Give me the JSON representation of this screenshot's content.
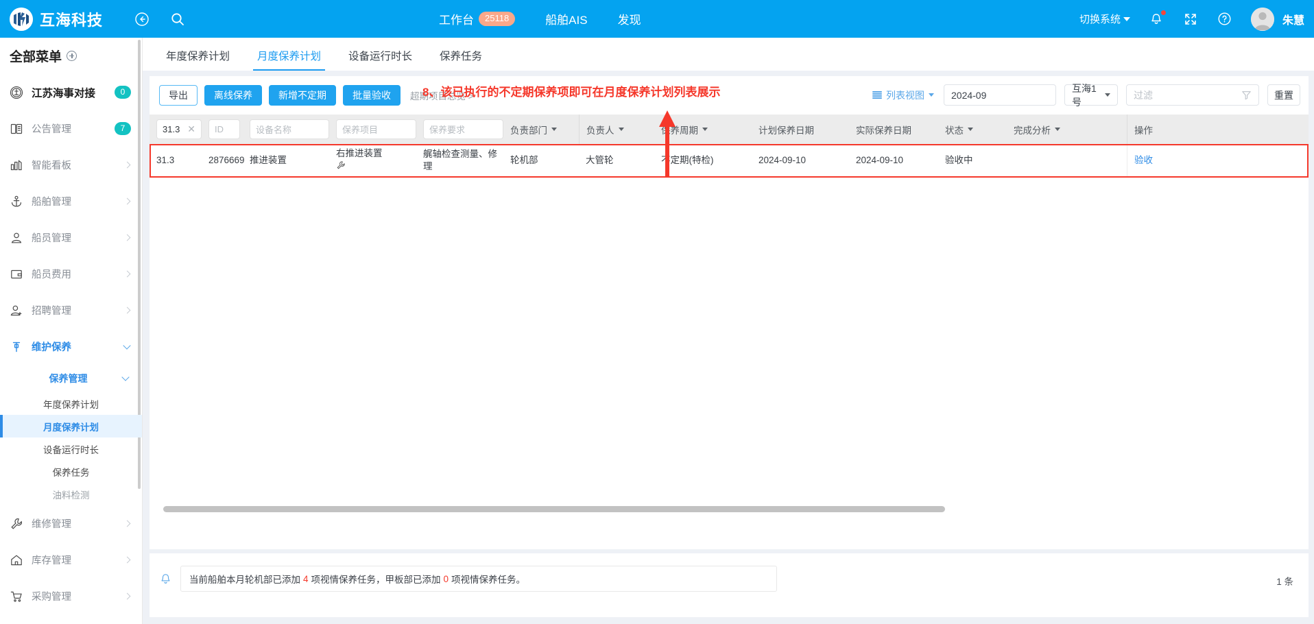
{
  "header": {
    "brand": "互海科技",
    "back_icon": "back-arrow-icon",
    "search_icon": "search-icon",
    "center_links": [
      {
        "label": "工作台",
        "badge": "25118"
      },
      {
        "label": "船舶AIS",
        "badge": ""
      },
      {
        "label": "发现",
        "badge": ""
      }
    ],
    "switch_system": "切换系统",
    "user_name": "朱慧"
  },
  "sidebar": {
    "title": "全部菜单",
    "items": [
      {
        "label": "江苏海事对接",
        "badge": "0",
        "icon": "maritime-seal-icon",
        "arrow": "",
        "strong": true
      },
      {
        "label": "公告管理",
        "badge": "7",
        "icon": "book-icon",
        "arrow": ""
      },
      {
        "label": "智能看板",
        "badge": "",
        "icon": "bar-chart-icon",
        "arrow": "chevron-right"
      },
      {
        "label": "船舶管理",
        "badge": "",
        "icon": "anchor-icon",
        "arrow": "chevron-right"
      },
      {
        "label": "船员管理",
        "badge": "",
        "icon": "user-icon",
        "arrow": "chevron-right"
      },
      {
        "label": "船员费用",
        "badge": "",
        "icon": "wallet-icon",
        "arrow": "chevron-right"
      },
      {
        "label": "招聘管理",
        "badge": "",
        "icon": "user-add-icon",
        "arrow": "chevron-right"
      },
      {
        "label": "维护保养",
        "badge": "",
        "icon": "maintenance-icon",
        "arrow": "chevron-down",
        "active": true
      }
    ],
    "sub_group": "保养管理",
    "leaves": [
      {
        "label": "年度保养计划",
        "selected": false,
        "muted": false
      },
      {
        "label": "月度保养计划",
        "selected": true,
        "muted": false
      },
      {
        "label": "设备运行时长",
        "selected": false,
        "muted": false
      },
      {
        "label": "保养任务",
        "selected": false,
        "muted": false
      },
      {
        "label": "油料检测",
        "selected": false,
        "muted": true
      }
    ],
    "tail_items": [
      {
        "label": "维修管理",
        "icon": "wrench-icon",
        "arrow": "chevron-right"
      },
      {
        "label": "库存管理",
        "icon": "home-icon",
        "arrow": "chevron-right"
      },
      {
        "label": "采购管理",
        "icon": "cart-icon",
        "arrow": "chevron-right"
      }
    ]
  },
  "tabs": [
    {
      "label": "年度保养计划",
      "active": false
    },
    {
      "label": "月度保养计划",
      "active": true
    },
    {
      "label": "设备运行时长",
      "active": false
    },
    {
      "label": "保养任务",
      "active": false
    }
  ],
  "toolbar": {
    "export_label": "导出",
    "offline_label": "离线保养",
    "add_irregular_label": "新增不定期",
    "batch_accept_label": "批量验收",
    "overdue_link": "超期项目总览 >",
    "annotation": "8、该已执行的不定期保养项即可在月度保养计划列表展示",
    "annotation_color": "#f5382b",
    "list_view_label": "列表视图",
    "month_value": "2024-09",
    "ship_value": "互海1号",
    "filter_placeholder": "过滤",
    "reset_label": "重置"
  },
  "table": {
    "filters": [
      {
        "name": "code-filter",
        "value": "31.3",
        "placeholder": "",
        "clearable": true
      },
      {
        "name": "id-filter",
        "value": "",
        "placeholder": "ID"
      },
      {
        "name": "equipment-name-filter",
        "value": "",
        "placeholder": "设备名称"
      },
      {
        "name": "maintenance-item-filter",
        "value": "",
        "placeholder": "保养项目"
      },
      {
        "name": "maintenance-requirement-filter",
        "value": "",
        "placeholder": "保养要求"
      }
    ],
    "columns": [
      {
        "label": "负责部门",
        "dropdown": true
      },
      {
        "label": "负责人",
        "dropdown": true
      },
      {
        "label": "保养周期",
        "dropdown": true
      },
      {
        "label": "计划保养日期",
        "dropdown": false
      },
      {
        "label": "实际保养日期",
        "dropdown": false
      },
      {
        "label": "状态",
        "dropdown": true
      },
      {
        "label": "完成分析",
        "dropdown": true
      },
      {
        "label": "操作",
        "dropdown": false
      }
    ],
    "rows": [
      {
        "code": "31.3",
        "id": "2876669",
        "equipment": "推进装置",
        "item": "右推进装置",
        "requirement": "艉轴检查测量、修理",
        "department": "轮机部",
        "owner": "大管轮",
        "cycle": "不定期(特检)",
        "plan_date": "2024-09-10",
        "actual_date": "2024-09-10",
        "status": "验收中",
        "analysis": "",
        "action": "验收"
      }
    ]
  },
  "footer": {
    "notice_prefix": "当前船舶本月轮机部已添加",
    "notice_count1": "4",
    "notice_mid": "项视情保养任务，甲板部已添加",
    "notice_count2": "0",
    "notice_suffix": "项视情保养任务。",
    "total_count": "1 条"
  },
  "colors": {
    "brand_blue": "#04a3f0",
    "accent_blue": "#1fa3ef",
    "annotation_red": "#f5382b",
    "badge_teal": "#13c2c2",
    "badge_orange": "#fba88a"
  }
}
